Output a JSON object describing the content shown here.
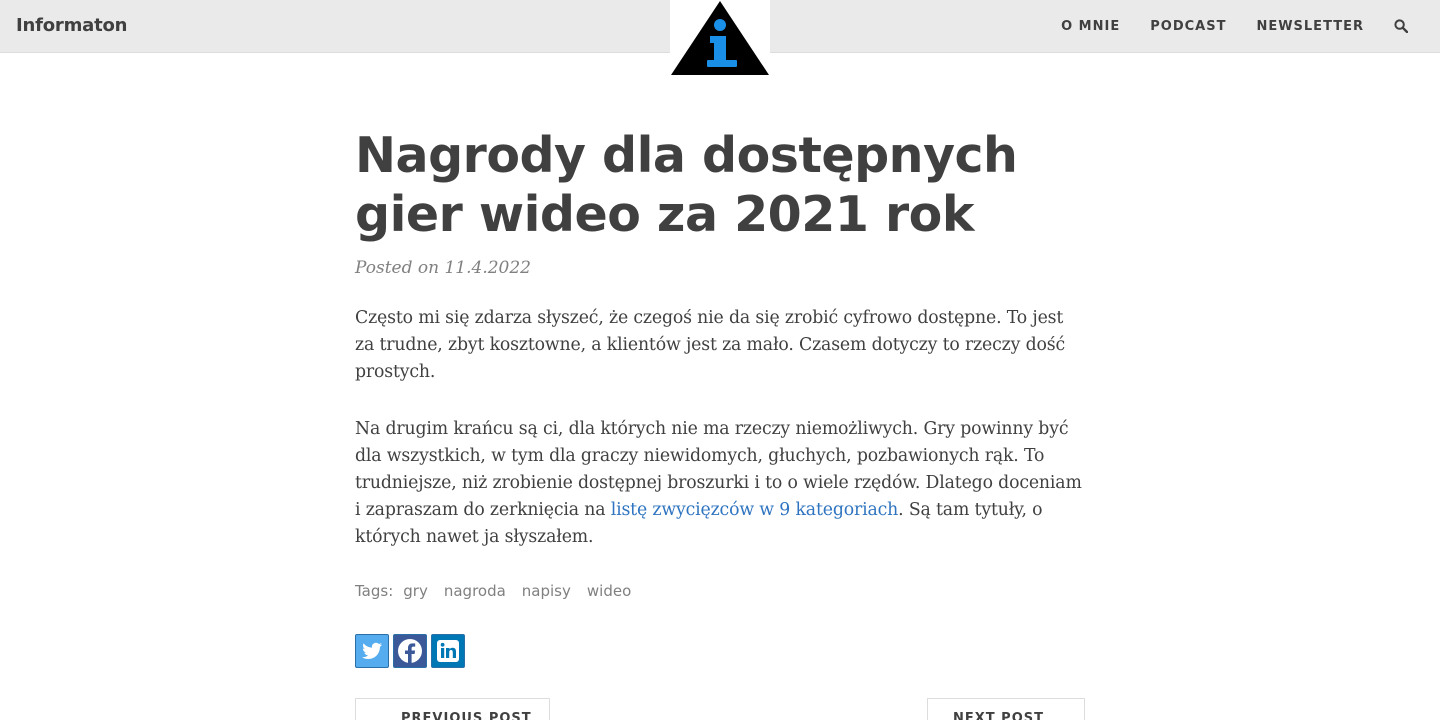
{
  "header": {
    "brand": "Informaton",
    "nav": [
      "O MNIE",
      "PODCAST",
      "NEWSLETTER"
    ],
    "search_icon": "search-icon",
    "logo_icon": "info-triangle-logo",
    "logo_colors": {
      "triangle": "#000000",
      "letter": "#1a8fe8"
    }
  },
  "post": {
    "title_line1": "Nagrody dla dostępnych",
    "title_line2": "gier wideo za 2021 rok",
    "meta": "Posted on 11.4.2022",
    "para1": "Często mi się zdarza słyszeć, że czegoś nie da się zrobić cyfrowo dostępne. To jest za trudne, zbyt kosztowne, a klientów jest za mało. Czasem dotyczy to rzeczy dość prostych.",
    "para2_before": "Na drugim krańcu są ci, dla których nie ma rzeczy niemożliwych. Gry powinny być dla wszystkich, w tym dla graczy niewidomych, głuchych, pozbawionych rąk. To trudniejsze, niż zrobienie dostępnej broszurki i to o wiele rzędów. Dlatego doceniam i zapraszam do zerknięcia na ",
    "para2_link": "listę zwycięzców w 9 kategoriach",
    "para2_after": ". Są tam tytuły, o których nawet ja słyszałem.",
    "link_color": "#2f74c0"
  },
  "tags": {
    "label": "Tags:",
    "items": [
      "gry",
      "nagroda",
      "napisy",
      "wideo"
    ]
  },
  "share": {
    "buttons": [
      "twitter-icon",
      "facebook-icon",
      "linkedin-icon"
    ],
    "colors": {
      "twitter": "#55acee",
      "facebook": "#3b5998",
      "linkedin": "#0077b5"
    }
  },
  "pager": {
    "prev": "PREVIOUS POST",
    "next": "NEXT POST"
  }
}
